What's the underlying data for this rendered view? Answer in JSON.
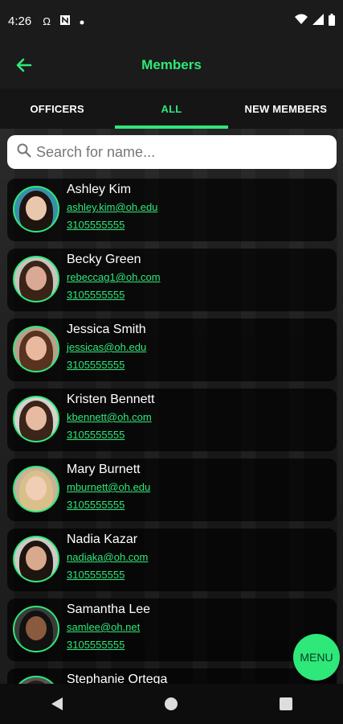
{
  "status_bar": {
    "time": "4:26",
    "icons": [
      "omega-icon",
      "news-icon",
      "dot-icon",
      "wifi-icon",
      "signal-icon",
      "battery-icon"
    ]
  },
  "app_bar": {
    "title": "Members",
    "back_icon": "arrow-left-icon"
  },
  "tabs": [
    {
      "label": "OFFICERS",
      "active": false
    },
    {
      "label": "ALL",
      "active": true
    },
    {
      "label": "NEW MEMBERS",
      "active": false
    }
  ],
  "search": {
    "placeholder": "Search for name..."
  },
  "members": [
    {
      "name": "Ashley Kim",
      "email": "ashley.kim@oh.edu",
      "phone": "3105555555"
    },
    {
      "name": "Becky Green",
      "email": "rebeccag1@oh.com",
      "phone": "3105555555"
    },
    {
      "name": "Jessica Smith",
      "email": "jessicas@oh.edu",
      "phone": "3105555555"
    },
    {
      "name": "Kristen Bennett",
      "email": "kbennett@oh.com",
      "phone": "3105555555"
    },
    {
      "name": "Mary Burnett",
      "email": "mburnett@oh.edu",
      "phone": "3105555555"
    },
    {
      "name": "Nadia Kazar",
      "email": "nadiaka@oh.com",
      "phone": "3105555555"
    },
    {
      "name": "Samantha Lee",
      "email": "samlee@oh.net",
      "phone": "3105555555"
    },
    {
      "name": "Stephanie Ortega",
      "email": "",
      "phone": ""
    }
  ],
  "fab": {
    "label": "MENU"
  },
  "nav_bar": {
    "icons": [
      "back-triangle-icon",
      "home-circle-icon",
      "recents-square-icon"
    ]
  },
  "colors": {
    "accent": "#2ee879",
    "bar": "#1b1b1b"
  }
}
